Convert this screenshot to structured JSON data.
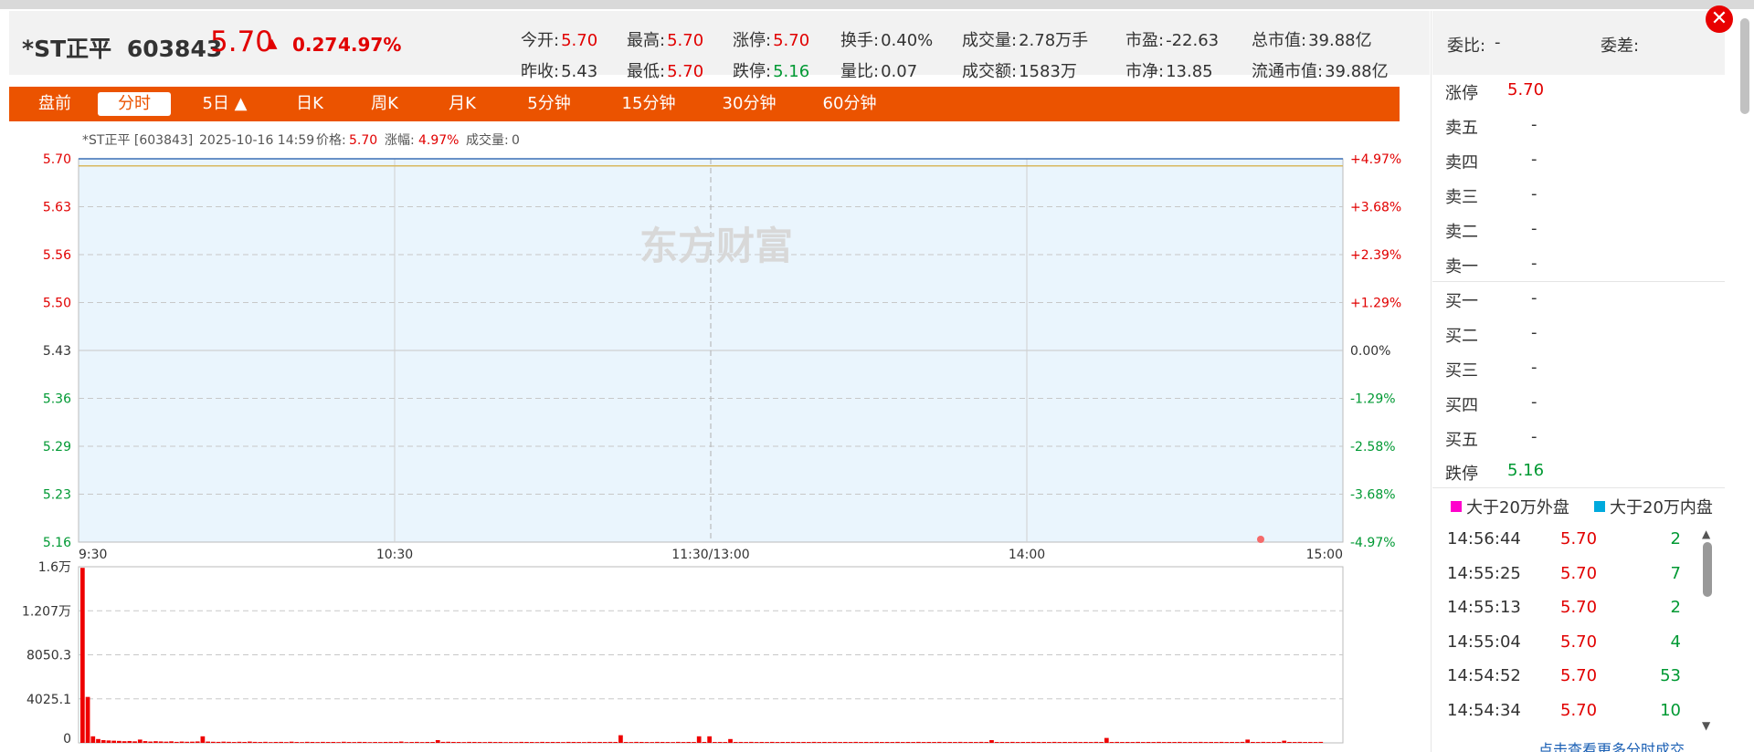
{
  "header": {
    "name": "*ST正平",
    "code": "603843",
    "price": "5.70",
    "change": "0.27",
    "change_pct": "4.97%",
    "quotes": [
      {
        "label": "今开:",
        "value": "5.70",
        "color": "red"
      },
      {
        "label": "最高:",
        "value": "5.70",
        "color": "red"
      },
      {
        "label": "涨停:",
        "value": "5.70",
        "color": "red"
      },
      {
        "label": "换手:",
        "value": "0.40%",
        "color": "plain"
      },
      {
        "label": "成交量:",
        "value": "2.78万手",
        "color": "plain"
      },
      {
        "label": "市盈:",
        "value": "-22.63",
        "color": "plain"
      },
      {
        "label": "总市值:",
        "value": "39.88亿",
        "color": "plain"
      },
      {
        "label": "昨收:",
        "value": "5.43",
        "color": "plain"
      },
      {
        "label": "最低:",
        "value": "5.70",
        "color": "red"
      },
      {
        "label": "跌停:",
        "value": "5.16",
        "color": "green"
      },
      {
        "label": "量比:",
        "value": "0.07",
        "color": "plain"
      },
      {
        "label": "成交额:",
        "value": "1583万",
        "color": "plain"
      },
      {
        "label": "市净:",
        "value": "13.85",
        "color": "plain"
      },
      {
        "label": "流通市值:",
        "value": "39.88亿",
        "color": "plain"
      }
    ]
  },
  "tabs": [
    "盘前",
    "分时",
    "5日 ▲",
    "日K",
    "周K",
    "月K",
    "5分钟",
    "15分钟",
    "30分钟",
    "60分钟"
  ],
  "active_tab": 1,
  "chart_info": {
    "name": "*ST正平 [603843]",
    "datetime": "2025-10-16 14:59",
    "price_label": "价格:",
    "price": "5.70",
    "pct_label": "涨幅:",
    "pct": "4.97%",
    "vol_label": "成交量:",
    "vol": "0",
    "watermark": "东方财富"
  },
  "chart_data": [
    {
      "type": "line",
      "x_ticks": [
        "9:30",
        "10:30",
        "11:30/13:00",
        "14:00",
        "15:00"
      ],
      "y_ticks_left": [
        "5.70",
        "5.63",
        "5.56",
        "5.50",
        "5.43",
        "5.36",
        "5.29",
        "5.23",
        "5.16"
      ],
      "y_ticks_right": [
        "+4.97%",
        "+3.68%",
        "+2.39%",
        "+1.29%",
        "0.00%",
        "-1.29%",
        "-2.58%",
        "-3.68%",
        "-4.97%"
      ],
      "ylim": [
        5.16,
        5.7
      ],
      "prev_close": 5.43,
      "series": [
        {
          "values": [
            5.7,
            5.7,
            5.7,
            5.7,
            5.7
          ],
          "color": "#3a6fb5"
        },
        {
          "values": [
            5.69,
            5.69,
            5.69,
            5.69,
            5.69
          ],
          "color": "#d8b860"
        }
      ]
    },
    {
      "type": "bar",
      "y_ticks": [
        "1.6万",
        "1.207万",
        "8050.3",
        "4025.1",
        "0"
      ],
      "ylim": [
        0,
        16101
      ],
      "color": "#ee0000",
      "values": [
        16000,
        4200,
        600,
        350,
        250,
        220,
        200,
        180,
        150,
        170,
        140,
        300,
        160,
        120,
        150,
        130,
        110,
        140,
        90,
        120,
        100,
        110,
        130,
        600,
        120,
        100,
        90,
        110,
        95,
        80,
        100,
        85,
        120,
        90,
        80,
        95,
        70,
        85,
        90,
        75,
        110,
        80,
        70,
        95,
        85,
        75,
        90,
        80,
        85,
        70,
        100,
        80,
        75,
        90,
        85,
        70,
        80,
        75,
        85,
        90,
        80,
        120,
        70,
        80,
        90,
        75,
        85,
        80,
        250,
        90,
        100,
        85,
        80,
        75,
        90,
        85,
        80,
        75,
        90,
        80,
        85,
        70,
        80,
        75,
        90,
        85,
        80,
        75,
        90,
        80,
        85,
        80,
        75,
        90,
        85,
        80,
        75,
        90,
        80,
        85,
        80,
        90,
        85,
        700,
        80,
        75,
        90,
        85,
        80,
        75,
        90,
        85,
        80,
        75,
        90,
        80,
        85,
        80,
        600,
        85,
        600,
        80,
        85,
        80,
        350,
        80,
        85,
        80,
        90,
        80,
        85,
        80,
        90,
        80,
        85,
        80,
        90,
        80,
        85,
        80,
        90,
        80,
        85,
        80,
        90,
        80,
        85,
        80,
        90,
        80,
        85,
        80,
        90,
        80,
        85,
        80,
        90,
        80,
        85,
        80,
        90,
        80,
        85,
        80,
        90,
        80,
        85,
        80,
        90,
        80,
        85,
        80,
        90,
        80,
        250,
        80,
        85,
        80,
        90,
        80,
        85,
        80,
        90,
        80,
        85,
        80,
        90,
        80,
        85,
        80,
        90,
        80,
        85,
        80,
        90,
        80,
        450,
        80,
        90,
        80,
        85,
        80,
        90,
        80,
        85,
        80,
        90,
        80,
        85,
        80,
        90,
        80,
        85,
        80,
        90,
        80,
        85,
        80,
        90,
        80,
        85,
        80,
        90,
        300,
        85,
        80,
        90,
        80,
        85,
        80,
        200,
        85,
        80,
        90,
        80,
        85,
        80,
        90
      ]
    }
  ],
  "orderbook": {
    "wb_label": "委比:",
    "wb_value": "-",
    "wc_label": "委差:",
    "wc_value": "",
    "zt_label": "涨停",
    "zt_value": "5.70",
    "sells": [
      {
        "label": "卖五",
        "value": "-"
      },
      {
        "label": "卖四",
        "value": "-"
      },
      {
        "label": "卖三",
        "value": "-"
      },
      {
        "label": "卖二",
        "value": "-"
      },
      {
        "label": "卖一",
        "value": "-"
      }
    ],
    "buys": [
      {
        "label": "买一",
        "value": "-"
      },
      {
        "label": "买二",
        "value": "-"
      },
      {
        "label": "买三",
        "value": "-"
      },
      {
        "label": "买四",
        "value": "-"
      },
      {
        "label": "买五",
        "value": "-"
      }
    ],
    "dt_label": "跌停",
    "dt_value": "5.16"
  },
  "legend": {
    "outer": "大于20万外盘",
    "outer_color": "#ff00cc",
    "inner": "大于20万内盘",
    "inner_color": "#00aadd"
  },
  "ticks": [
    {
      "time": "14:56:44",
      "price": "5.70",
      "vol": "2"
    },
    {
      "time": "14:55:25",
      "price": "5.70",
      "vol": "7"
    },
    {
      "time": "14:55:13",
      "price": "5.70",
      "vol": "2"
    },
    {
      "time": "14:55:04",
      "price": "5.70",
      "vol": "4"
    },
    {
      "time": "14:54:52",
      "price": "5.70",
      "vol": "53"
    },
    {
      "time": "14:54:34",
      "price": "5.70",
      "vol": "10"
    }
  ],
  "more_link": "点击查看更多分时成交",
  "close_label": "✕"
}
